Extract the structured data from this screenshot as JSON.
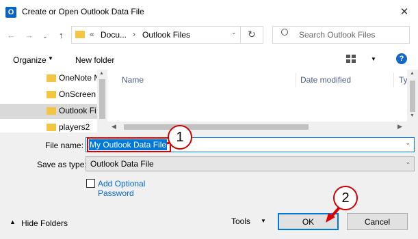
{
  "window": {
    "title": "Create or Open Outlook Data File",
    "app_icon_letter": "O"
  },
  "address": {
    "overflow": "«",
    "crumbs": [
      "Docu...",
      "Outlook Files"
    ],
    "search_placeholder": "Search Outlook Files"
  },
  "toolbar": {
    "organize_label": "Organize",
    "new_folder_label": "New folder",
    "help_label": "?"
  },
  "nav_items": [
    {
      "label": "OneNote N"
    },
    {
      "label": "OnScreen"
    },
    {
      "label": "Outlook Fi",
      "selected": true
    },
    {
      "label": "players2"
    }
  ],
  "columns": [
    "Name",
    "Date modified",
    "Ty"
  ],
  "form": {
    "file_name_label": "File name:",
    "file_name_value": "My Outlook Data File",
    "save_as_type_label": "Save as type:",
    "save_as_type_value": "Outlook Data File",
    "add_optional_password": "Add Optional\nPassword"
  },
  "footer": {
    "hide_folders": "Hide Folders",
    "tools": "Tools",
    "ok": "OK",
    "cancel": "Cancel"
  },
  "annotations": {
    "step1": "1",
    "step2": "2",
    "color": "#d00000"
  }
}
